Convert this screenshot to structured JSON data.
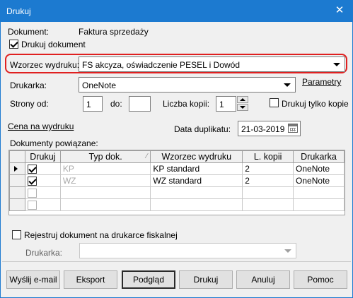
{
  "window": {
    "title": "Drukuj",
    "close_glyph": "✕"
  },
  "document": {
    "label": "Dokument:",
    "value": "Faktura sprzedaży"
  },
  "print_document": {
    "label": "Drukuj dokument",
    "checked": true
  },
  "template": {
    "label": "Wzorzec wydruku:",
    "value": "FS akcyza, oświadczenie PESEL i Dowód"
  },
  "printer": {
    "label": "Drukarka:",
    "value": "OneNote",
    "params_link": "Parametry"
  },
  "pages": {
    "from_label": "Strony od:",
    "from_value": "1",
    "to_label": "do:",
    "to_value": "",
    "copies_label": "Liczba kopii:",
    "copies_value": "1",
    "only_copies_label": "Drukuj tylko kopie",
    "only_copies_checked": false
  },
  "price_link": "Cena na wydruku",
  "duplicate": {
    "label": "Data duplikatu:",
    "value": "21-03-2019"
  },
  "related": {
    "label": "Dokumenty powiązane:",
    "columns": [
      "Drukuj",
      "Typ dok.",
      "Wzorzec wydruku",
      "L. kopii",
      "Drukarka"
    ],
    "rows": [
      {
        "print": true,
        "type": "KP",
        "template": "KP standard",
        "copies": "2",
        "printer": "OneNote"
      },
      {
        "print": true,
        "type": "WZ",
        "template": "WZ standard",
        "copies": "2",
        "printer": "OneNote"
      },
      {
        "print": false,
        "type": "",
        "template": "",
        "copies": "",
        "printer": ""
      },
      {
        "print": false,
        "type": "",
        "template": "",
        "copies": "",
        "printer": ""
      }
    ]
  },
  "fiscal": {
    "label": "Rejestruj dokument na drukarce fiskalnej",
    "checked": false,
    "printer_label": "Drukarka:",
    "printer_value": ""
  },
  "buttons": {
    "email": "Wyślij e-mail",
    "export": "Eksport",
    "preview": "Podgląd",
    "print": "Drukuj",
    "cancel": "Anuluj",
    "help": "Pomoc"
  },
  "colors": {
    "titlebar": "#1c7ad0",
    "highlight": "#e02020",
    "grey_text": "#a8a8a8"
  },
  "icons": [
    "close-icon",
    "dropdown-arrow-icon",
    "spin-up-icon",
    "spin-down-icon",
    "calendar-icon",
    "row-pointer-icon",
    "sort-icon"
  ]
}
